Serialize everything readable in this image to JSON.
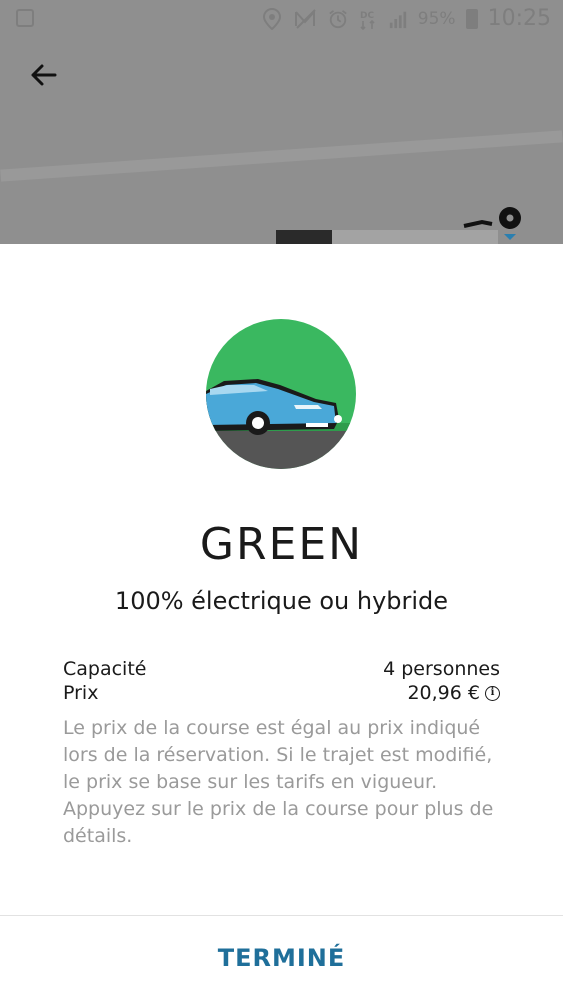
{
  "status_bar": {
    "battery": "95%",
    "time": "10:25",
    "icons": [
      "image-icon",
      "location-icon",
      "no-signal-icon",
      "alarm-icon",
      "data-icon",
      "cellular-icon",
      "battery-icon"
    ]
  },
  "back_button": {
    "icon": "arrow-left-icon"
  },
  "vehicle": {
    "title": "GREEN",
    "subtitle": "100% électrique ou hybride",
    "image_colors": {
      "sky": "#3ab860",
      "road": "#555555",
      "car": "#4aa8d8"
    }
  },
  "details": {
    "capacity_label": "Capacité",
    "capacity_value": "4 personnes",
    "price_label": "Prix",
    "price_value": "20,96 €",
    "note": "Le prix de la course est égal au prix indiqué lors de la réservation. Si le trajet est modifié, le prix se base sur les tarifs en vigueur. Appuyez sur le prix de la course pour plus de détails."
  },
  "actions": {
    "done_label": "TERMINÉ"
  },
  "colors": {
    "accent": "#1f6f9a",
    "text": "#1a1a1a",
    "muted": "#9a9a9a"
  }
}
